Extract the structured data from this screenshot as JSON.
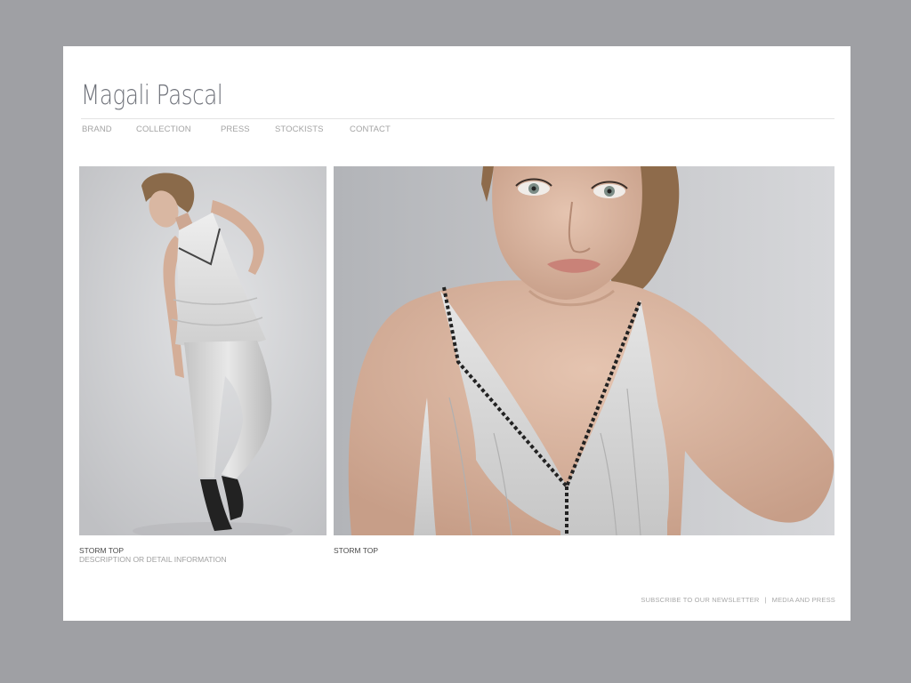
{
  "brand": {
    "name": "Magali Pascal"
  },
  "nav": {
    "items": [
      {
        "label": "BRAND"
      },
      {
        "label": "COLLECTION"
      },
      {
        "label": "PRESS"
      },
      {
        "label": "STOCKISTS"
      },
      {
        "label": "CONTACT"
      }
    ]
  },
  "gallery": {
    "items": [
      {
        "title": "STORM TOP",
        "description": "DESCRIPTION OR DETAIL INFORMATION"
      },
      {
        "title": "STORM TOP"
      }
    ]
  },
  "footer": {
    "newsletter_label": "SUBSCRIBE TO OUR NEWSLETTER",
    "separator": "|",
    "media_label": "MEDIA AND PRESS"
  },
  "colors": {
    "page_background": "#9fa0a4",
    "content_background": "#ffffff",
    "logo_text": "#6f727a",
    "nav_text": "#a4a4a4"
  }
}
